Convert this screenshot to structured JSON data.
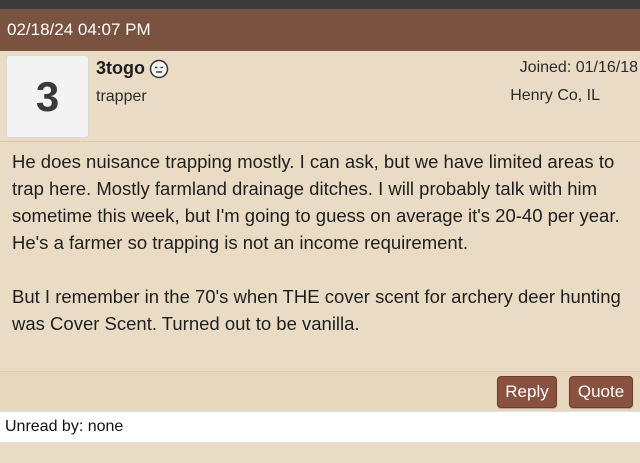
{
  "post": {
    "timestamp": "02/18/24 04:07 PM",
    "avatar_text": "3",
    "username": "3togo",
    "user_title": "trapper",
    "joined": "Joined: 01/16/18",
    "location": "Henry Co, IL",
    "status_icon": "status-face-icon",
    "paragraphs": [
      "He does nuisance trapping mostly. I can ask, but we have limited areas to trap here. Mostly farmland drainage ditches. I will probably talk with him sometime this week, but I'm going to guess on average it's 20-40 per year. He's a farmer so trapping is not an income requirement.",
      "But I remember in the 70's when THE cover scent for archery deer hunting was Cover Scent. Turned out to be vanilla."
    ]
  },
  "actions": {
    "reply_label": "Reply",
    "quote_label": "Quote"
  },
  "unread": {
    "text": "Unread by: none"
  },
  "colors": {
    "header_bg": "#7a5240",
    "post_bg": "#eadcc4",
    "button_bg": "#8a5141"
  }
}
